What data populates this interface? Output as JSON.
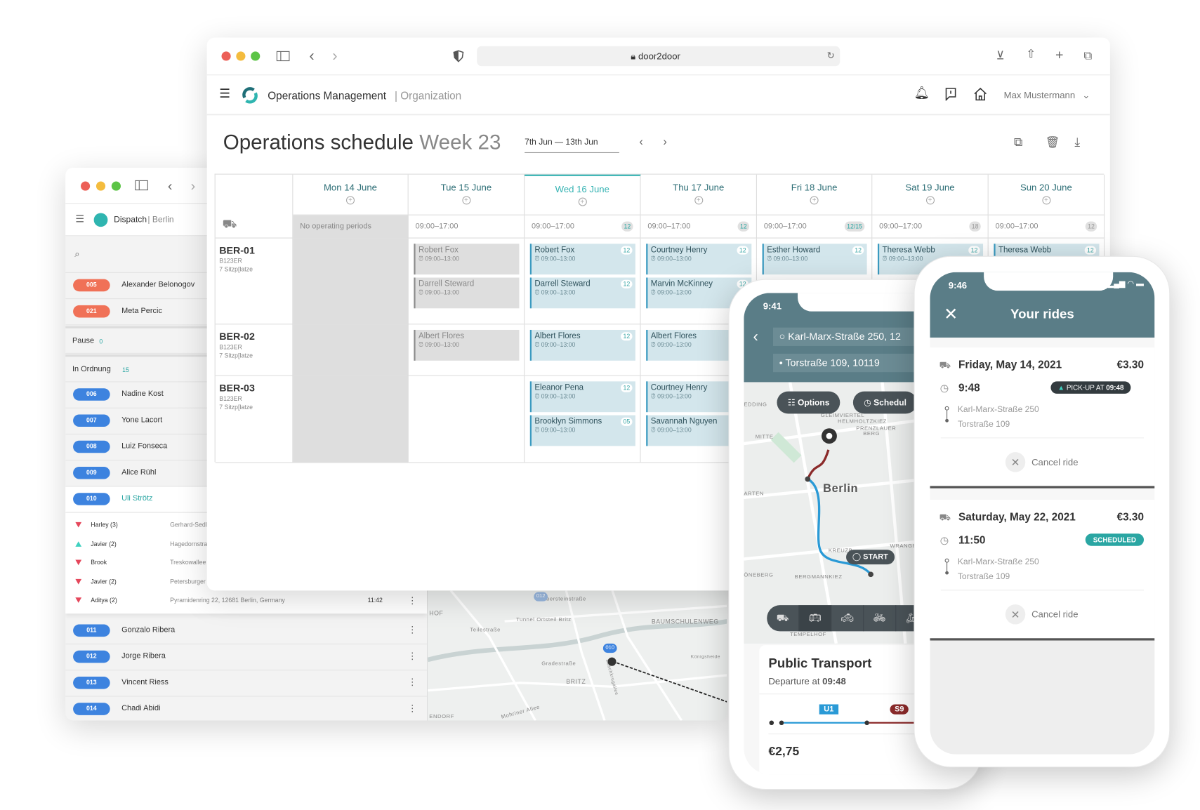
{
  "browser": {
    "url": "door2door"
  },
  "app": {
    "title": "Operations Management",
    "section": "Organization",
    "user": "Max Mustermann"
  },
  "schedule": {
    "title": "Operations schedule",
    "week": "Week 23",
    "date_range": "7th Jun — 13th Jun",
    "days": [
      {
        "label": "Mon 14  June",
        "ops": "No operating periods",
        "badge": null,
        "closed": true
      },
      {
        "label": "Tue 15 June",
        "ops": "09:00–17:00",
        "badge": null
      },
      {
        "label": "Wed 16 June",
        "ops": "09:00–17:00",
        "badge": "12",
        "active": true
      },
      {
        "label": "Thu 17 June",
        "ops": "09:00–17:00",
        "badge": "12"
      },
      {
        "label": "Fri 18 June",
        "ops": "09:00–17:00",
        "badge": "12/15"
      },
      {
        "label": "Sat 19 June",
        "ops": "09:00–17:00",
        "badge": "18"
      },
      {
        "label": "Sun 20 June",
        "ops": "09:00–17:00",
        "badge": "12"
      }
    ],
    "vehicles": [
      {
        "id": "BER-01",
        "plate": "B123ER",
        "seats": "7 Sitzp[latze"
      },
      {
        "id": "BER-02",
        "plate": "B123ER",
        "seats": "7 Sitzp[latze"
      },
      {
        "id": "BER-03",
        "plate": "B123ER",
        "seats": "7 Sitzp[latze"
      }
    ],
    "shifts": [
      {
        "vehicle": 0,
        "day": 1,
        "slot": 0,
        "driver": "Robert Fox",
        "time": "09:00–13:00",
        "inactive": true
      },
      {
        "vehicle": 0,
        "day": 1,
        "slot": 1,
        "driver": "Darrell Steward",
        "time": "09:00–13:00",
        "inactive": true
      },
      {
        "vehicle": 0,
        "day": 2,
        "slot": 0,
        "driver": "Robert Fox",
        "time": "09:00–13:00",
        "badge": "12"
      },
      {
        "vehicle": 0,
        "day": 2,
        "slot": 1,
        "driver": "Darrell Steward",
        "time": "09:00–13:00",
        "badge": "12"
      },
      {
        "vehicle": 0,
        "day": 3,
        "slot": 0,
        "driver": "Courtney Henry",
        "time": "09:00–13:00",
        "badge": "12"
      },
      {
        "vehicle": 0,
        "day": 3,
        "slot": 1,
        "driver": "Marvin McKinney",
        "time": "09:00–13:00",
        "badge": "12"
      },
      {
        "vehicle": 0,
        "day": 4,
        "slot": 0,
        "driver": "Esther Howard",
        "time": "09:00–13:00",
        "badge": "12"
      },
      {
        "vehicle": 0,
        "day": 5,
        "slot": 0,
        "driver": "Theresa Webb",
        "time": "09:00–13:00",
        "badge": "12"
      },
      {
        "vehicle": 0,
        "day": 6,
        "slot": 0,
        "driver": "Theresa Webb",
        "time": "09:00–13:00",
        "badge": "12"
      },
      {
        "vehicle": 1,
        "day": 1,
        "slot": 0,
        "driver": "Albert Flores",
        "time": "09:00–13:00",
        "inactive": true
      },
      {
        "vehicle": 1,
        "day": 2,
        "slot": 0,
        "driver": "Albert Flores",
        "time": "09:00–13:00",
        "badge": "12"
      },
      {
        "vehicle": 1,
        "day": 3,
        "slot": 0,
        "driver": "Albert Flores",
        "time": "09:00–13:00"
      },
      {
        "vehicle": 2,
        "day": 2,
        "slot": 0,
        "driver": "Eleanor Pena",
        "time": "09:00–13:00",
        "badge": "12"
      },
      {
        "vehicle": 2,
        "day": 2,
        "slot": 1,
        "driver": "Brooklyn Simmons",
        "time": "09:00–13:00",
        "badge": "05"
      },
      {
        "vehicle": 2,
        "day": 3,
        "slot": 0,
        "driver": "Courtney Henry",
        "time": "09:00–13:00"
      },
      {
        "vehicle": 2,
        "day": 3,
        "slot": 1,
        "driver": "Savannah Nguyen",
        "time": "09:00–13:00"
      }
    ]
  },
  "dispatch": {
    "title": "Dispatch",
    "city": "Berlin",
    "alerts": [
      {
        "num": "005",
        "name": "Alexander Belonogov"
      },
      {
        "num": "021",
        "name": "Meta Percic"
      }
    ],
    "pause": {
      "label": "Pause",
      "count": "0"
    },
    "ok": {
      "label": "In Ordnung",
      "count": "15"
    },
    "drivers": [
      {
        "num": "006",
        "name": "Nadine Kost"
      },
      {
        "num": "007",
        "name": "Yone Lacort"
      },
      {
        "num": "008",
        "name": "Luiz Fonseca"
      },
      {
        "num": "009",
        "name": "Alice Rühl"
      },
      {
        "num": "010",
        "name": "Uli Strötz",
        "selected": true
      }
    ],
    "stops": [
      {
        "name": "Harley (3)",
        "address": "Gerhard-Sedl",
        "type": "dropoff"
      },
      {
        "name": "Javier (2)",
        "address": "Hagedornstra",
        "type": "pickup"
      },
      {
        "name": "Brook",
        "address": "Treskowallee",
        "type": "dropoff"
      },
      {
        "name": "Javier (2)",
        "address": "Petersburger",
        "type": "dropoff"
      },
      {
        "name": "Aditya (2)",
        "address": "Pyramidenring 22, 12681 Berlin, Germany",
        "time": "11:42",
        "type": "dropoff"
      }
    ],
    "more_drivers": [
      {
        "num": "011",
        "name": "Gonzalo Ribera"
      },
      {
        "num": "012",
        "name": "Jorge Ribera"
      },
      {
        "num": "013",
        "name": "Vincent Riess"
      },
      {
        "num": "014",
        "name": "Chadi Abidi"
      }
    ],
    "map": {
      "labels": [
        "Silbersteinstraße",
        "Tunnel Ortsteil Britz",
        "Teilestraße",
        "BAUMSCHULENWEG",
        "Gradestraße",
        "BRITZ",
        "Königsheide",
        "Buschkrugallee",
        "HOF",
        "ENDORF",
        "Mohriner Allee"
      ],
      "markers": [
        "012",
        "010"
      ]
    }
  },
  "phone_booking": {
    "status_time": "9:41",
    "from": "Karl-Marx-Straße 250, 12",
    "to": "Torstraße 109, 10119",
    "options_label": "Options",
    "schedule_label": "Schedul",
    "map_labels": [
      "EDDING",
      "GLEIMVIERTEL",
      "HELMHOLTZKIEZ",
      "PRENZLAUER BERG",
      "MITTE",
      "Berlin",
      "ARTEN",
      "KREUZB",
      "WRANGE",
      "ÖNEBERG",
      "BERGMANNKIEZ",
      "TEMPELHOF"
    ],
    "start_label": "START",
    "modes": [
      "van-icon",
      "bus-icon",
      "taxi-icon",
      "bike-icon",
      "scooter-icon"
    ],
    "option": {
      "title": "Public Transport",
      "departure_prefix": "Departure at",
      "departure": "09:48",
      "lines": [
        "U1",
        "S9"
      ],
      "price": "€2,75"
    }
  },
  "phone_rides": {
    "status_time": "9:46",
    "title": "Your rides",
    "rides": [
      {
        "date": "Friday, May 14, 2021",
        "price": "€3.30",
        "time": "9:48",
        "status_prefix": "PICK-UP AT",
        "status_time": "09:48",
        "from": "Karl-Marx-Straße 250",
        "to": "Torstraße 109",
        "cancel": "Cancel ride"
      },
      {
        "date": "Saturday, May 22, 2021",
        "price": "€3.30",
        "time": "11:50",
        "status": "SCHEDULED",
        "from": "Karl-Marx-Straße 250",
        "to": "Torstraße 109",
        "cancel": "Cancel ride"
      }
    ]
  },
  "colors": {
    "teal": "#2aa6a3",
    "alert": "#f07157",
    "driver_blue": "#3d83df",
    "header": "#5a7d87",
    "u1": "#2a9ad6",
    "s9": "#8b2a2a"
  }
}
